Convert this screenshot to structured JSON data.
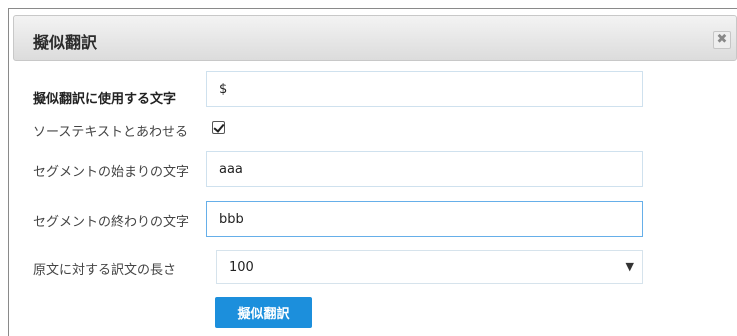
{
  "dialog": {
    "title": "擬似翻訳",
    "close_icon": "close-icon"
  },
  "form": {
    "pseudo_char_label": "擬似翻訳に使用する文字",
    "pseudo_char_value": "$",
    "combine_source_label": "ソーステキストとあわせる",
    "combine_source_checked": true,
    "segment_start_label": "セグメントの始まりの文字",
    "segment_start_value": "aaa",
    "segment_end_label": "セグメントの終わりの文字",
    "segment_end_value": "bbb",
    "length_label": "原文に対する訳文の長さ",
    "length_value": "100",
    "submit_label": "擬似翻訳"
  },
  "colors": {
    "accent": "#1c8fdc",
    "focus_border": "#66afe9"
  }
}
